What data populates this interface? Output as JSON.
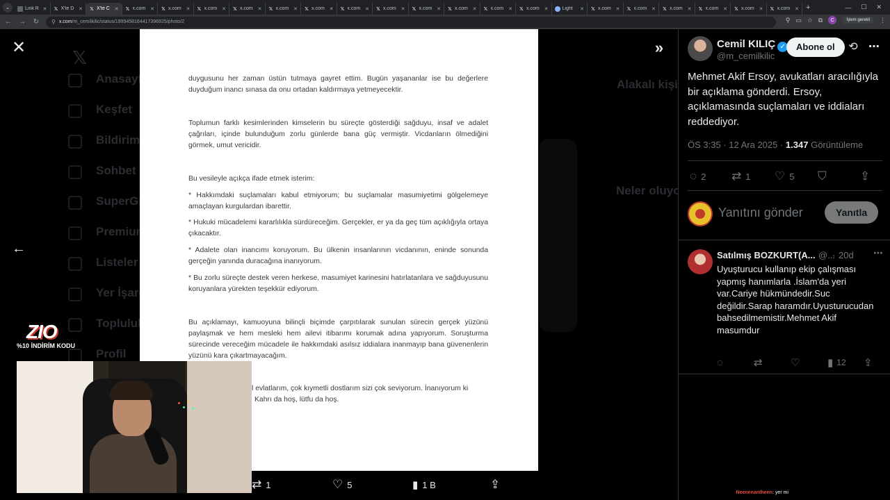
{
  "browser": {
    "tabs": [
      {
        "label": "Link R",
        "favicon": "doc"
      },
      {
        "label": "X'te D",
        "favicon": "x"
      },
      {
        "label": "X'te C",
        "favicon": "x",
        "active": true
      },
      {
        "label": "x.com",
        "favicon": "x"
      },
      {
        "label": "x.com",
        "favicon": "x"
      },
      {
        "label": "x.com",
        "favicon": "x"
      },
      {
        "label": "x.com",
        "favicon": "x"
      },
      {
        "label": "x.com",
        "favicon": "x"
      },
      {
        "label": "x.com",
        "favicon": "x"
      },
      {
        "label": "x.com",
        "favicon": "x"
      },
      {
        "label": "x.com",
        "favicon": "x"
      },
      {
        "label": "x.com",
        "favicon": "x"
      },
      {
        "label": "x.com",
        "favicon": "x"
      },
      {
        "label": "x.com",
        "favicon": "x"
      },
      {
        "label": "x.com",
        "favicon": "x"
      },
      {
        "label": "Light",
        "favicon": "light"
      },
      {
        "label": "x.com",
        "favicon": "x"
      },
      {
        "label": "x.com",
        "favicon": "x"
      },
      {
        "label": "x.com",
        "favicon": "x"
      },
      {
        "label": "x.com",
        "favicon": "x"
      },
      {
        "label": "x.com",
        "favicon": "x"
      },
      {
        "label": "x.com",
        "favicon": "x"
      }
    ],
    "url_host": "x.com",
    "url_path": "/m_cemilkilic/status/1999458164417396925/photo/2",
    "action_label": "İşlem gerekli",
    "profile_initial": "C"
  },
  "background_ghost": {
    "nav_items": [
      "Anasayfa",
      "Keşfet",
      "Bildirimler",
      "Sohbet",
      "SuperGrok",
      "Premium",
      "Listeler",
      "Yer İşaretleri",
      "Topluluklar",
      "Profil"
    ],
    "related_title": "Alakalı kişiler",
    "trends_title": "Neler oluyor"
  },
  "document": {
    "paragraphs": [
      "duygusunu her zaman üstün tutmaya gayret ettim. Bugün yaşananlar ise bu değerlere duyduğum inancı sınasa da onu ortadan kaldırmaya yetmeyecektir.",
      "Toplumun farklı kesimlerinden kimselerin bu süreçte gösterdiği sağduyu, insaf ve adalet çağrıları, içinde bulunduğum zorlu günlerde bana güç vermiştir. Vicdanların ölmediğini görmek, umut vericidir.",
      "Bu vesileyle açıkça ifade etmek isterim:",
      "* Hakkımdaki suçlamaları kabul etmiyorum; bu suçlamalar masumiyetimi gölgelemeye amaçlayan kurgulardan ibarettir.",
      "* Hukuki mücadelemi kararlılıkla sürdüreceğim. Gerçekler, er ya da geç tüm açıklığıyla ortaya çıkacaktır.",
      "* Adalete olan inancımı koruyorum. Bu ülkenin insanlarının vicdanının, eninde sonunda gerçeğin yanında duracağına inanıyorum.",
      "* Bu zorlu süreçte destek veren herkese, masumiyet karinesini hatırlatanlara ve sağduyusunu koruyanlara yürekten teşekkür ediyorum.",
      "Bu açıklamayı, kamuoyuna bilinçli biçimde çarpıtılarak sunulan sürecin gerçek yüzünü paylaşmak ve hem mesleki hem ailevi itibarımı korumak adına yapıyorum. Soruşturma sürecinde vereceğim mücadele ile hakkımdaki asılsız iddialara inanmayıp bana güvenenlerin yüzünü kara çıkartmayacağım.",
      "l evlatlarım, çok kıymetli dostlarım sizi çok seviyorum. İnanıyorum ki",
      "Kahrı da hoş, lütfu da hoş."
    ]
  },
  "photo_actions": {
    "retweets": "1",
    "likes": "5",
    "views": "1 B"
  },
  "overlay": {
    "logo_text": "ZIO",
    "discount_text": "%10 İNDİRİM KODU"
  },
  "tweet": {
    "author_name": "Cemil KILIÇ",
    "author_handle": "@m_cemilkilic",
    "follow_label": "Abone ol",
    "text": "Mehmet Akif Ersoy, avukatları aracılığıyla bir açıklama gönderdi. Ersoy, açıklamasında suçlamaları ve iddiaları reddediyor.",
    "time": "ÖS 3:35 · 12 Ara 2025 · ",
    "views_count": "1.347",
    "views_label": " Görüntüleme",
    "replies": "2",
    "retweets": "1",
    "likes": "5"
  },
  "composer": {
    "placeholder": "Yanıtını gönder",
    "button": "Yanıtla"
  },
  "reply": {
    "name": "Satılmış BOZKURT(A...",
    "handle": "@...",
    "time": "20d",
    "text": "Uyuşturucu kullanıp ekip çalışması yapmış hanımlarla .İslam'da yeri var.Cariye hükmündedir.Suc değildir.Sarap haramdır.Uyusturucudan bahsedilmemistir.Mehmet Akif masumdur",
    "views": "12"
  },
  "chat": {
    "name": "Neenenanthenn",
    "message": ": yer mi"
  },
  "colors": {
    "accent": "#1d9bf0",
    "background": "#000000",
    "document": "#ffffff"
  }
}
